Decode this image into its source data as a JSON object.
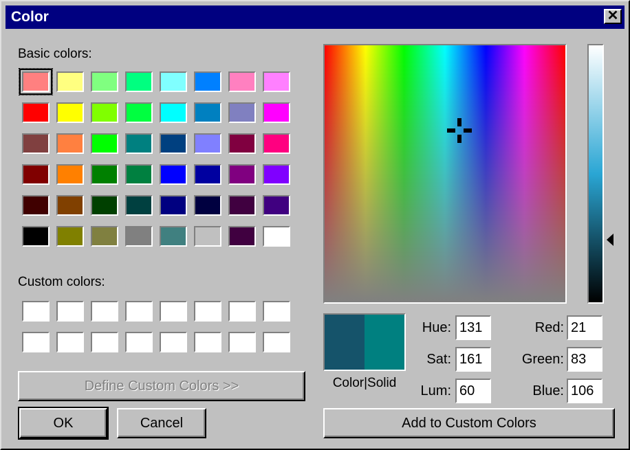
{
  "window": {
    "title": "Color"
  },
  "labels": {
    "basic_colors": "Basic colors:",
    "custom_colors": "Custom colors:",
    "color_solid": "Color|Solid",
    "hue": "Hue:",
    "sat": "Sat:",
    "lum": "Lum:",
    "red": "Red:",
    "green": "Green:",
    "blue": "Blue:"
  },
  "buttons": {
    "define": "Define Custom Colors >>",
    "ok": "OK",
    "cancel": "Cancel",
    "add": "Add to Custom Colors"
  },
  "values": {
    "hue": "131",
    "sat": "161",
    "lum": "60",
    "red": "21",
    "green": "83",
    "blue": "106"
  },
  "basic_colors": [
    [
      "#ff8080",
      "#ffff80",
      "#80ff80",
      "#00ff80",
      "#80ffff",
      "#0080ff",
      "#ff80c0",
      "#ff80ff"
    ],
    [
      "#ff0000",
      "#ffff00",
      "#80ff00",
      "#00ff40",
      "#00ffff",
      "#0080c0",
      "#8080c0",
      "#ff00ff"
    ],
    [
      "#804040",
      "#ff8040",
      "#00ff00",
      "#008080",
      "#004080",
      "#8080ff",
      "#800040",
      "#ff0080"
    ],
    [
      "#800000",
      "#ff8000",
      "#008000",
      "#008040",
      "#0000ff",
      "#0000a0",
      "#800080",
      "#8000ff"
    ],
    [
      "#400000",
      "#804000",
      "#004000",
      "#004040",
      "#000080",
      "#000040",
      "#400040",
      "#400080"
    ],
    [
      "#000000",
      "#808000",
      "#808040",
      "#808080",
      "#408080",
      "#c0c0c0",
      "#400040",
      "#ffffff"
    ]
  ],
  "custom_colors": [
    [
      "#ffffff",
      "#ffffff",
      "#ffffff",
      "#ffffff",
      "#ffffff",
      "#ffffff",
      "#ffffff",
      "#ffffff"
    ],
    [
      "#ffffff",
      "#ffffff",
      "#ffffff",
      "#ffffff",
      "#ffffff",
      "#ffffff",
      "#ffffff",
      "#ffffff"
    ]
  ],
  "preview": {
    "color": "#15536a",
    "solid": "#008080"
  }
}
